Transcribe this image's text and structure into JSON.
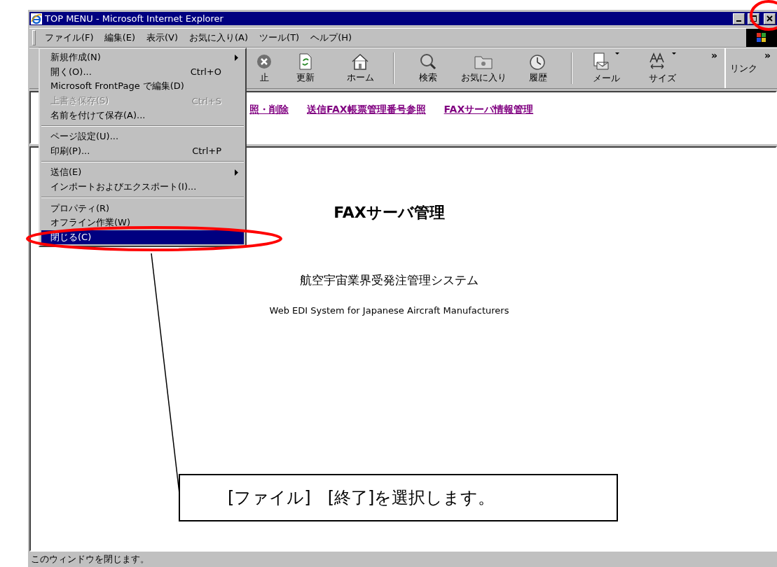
{
  "window": {
    "title": "TOP MENU - Microsoft Internet Explorer"
  },
  "menu_bar": [
    {
      "label": "ファイル(F)",
      "selected": true
    },
    {
      "label": "編集(E)",
      "selected": false
    },
    {
      "label": "表示(V)",
      "selected": false
    },
    {
      "label": "お気に入り(A)",
      "selected": false
    },
    {
      "label": "ツール(T)",
      "selected": false
    },
    {
      "label": "ヘルプ(H)",
      "selected": false
    }
  ],
  "toolbar": {
    "buttons": [
      {
        "label": "止",
        "dropdown": false
      },
      {
        "label": "更新",
        "dropdown": false
      },
      {
        "label": "ホーム",
        "dropdown": false
      },
      {
        "label": "検索",
        "dropdown": false
      },
      {
        "label": "お気に入り",
        "dropdown": false
      },
      {
        "label": "履歴",
        "dropdown": false
      },
      {
        "label": "メール",
        "dropdown": true
      },
      {
        "label": "サイズ",
        "dropdown": true
      }
    ],
    "more": "»",
    "links": "リンク",
    "links_more": "»"
  },
  "file_menu": [
    {
      "kind": "item",
      "label": "新規作成(N)",
      "submenu": true,
      "disabled": false,
      "selected": false
    },
    {
      "kind": "item",
      "label": "開く(O)...",
      "shortcut": "Ctrl+O",
      "submenu": false,
      "disabled": false,
      "selected": false
    },
    {
      "kind": "item",
      "label": "Microsoft FrontPage  で編集(D)",
      "submenu": false,
      "disabled": false,
      "selected": false
    },
    {
      "kind": "item",
      "label": "上書き保存(S)",
      "shortcut": "Ctrl+S",
      "submenu": false,
      "disabled": true,
      "selected": false
    },
    {
      "kind": "item",
      "label": "名前を付けて保存(A)...",
      "submenu": false,
      "disabled": false,
      "selected": false
    },
    {
      "kind": "separator"
    },
    {
      "kind": "item",
      "label": "ページ設定(U)...",
      "submenu": false,
      "disabled": false,
      "selected": false
    },
    {
      "kind": "item",
      "label": "印刷(P)...",
      "shortcut": "Ctrl+P",
      "submenu": false,
      "disabled": false,
      "selected": false
    },
    {
      "kind": "separator"
    },
    {
      "kind": "item",
      "label": "送信(E)",
      "submenu": true,
      "disabled": false,
      "selected": false
    },
    {
      "kind": "item",
      "label": "インポートおよびエクスポート(I)...",
      "submenu": false,
      "disabled": false,
      "selected": false
    },
    {
      "kind": "separator"
    },
    {
      "kind": "item",
      "label": "プロパティ(R)",
      "submenu": false,
      "disabled": false,
      "selected": false
    },
    {
      "kind": "item",
      "label": "オフライン作業(W)",
      "submenu": false,
      "disabled": false,
      "selected": false
    },
    {
      "kind": "item",
      "label": "閉じる(C)",
      "submenu": false,
      "disabled": false,
      "selected": true
    }
  ],
  "nav_links": [
    "照・削除",
    "送信FAX帳票管理番号参照",
    "FAXサーバ情報管理"
  ],
  "page": {
    "title": "FAXサーバ管理",
    "subtitle": "航空宇宙業界受発注管理システム",
    "subtitle_en": "Web EDI System for Japanese Aircraft Manufacturers"
  },
  "status_bar": "このウィンドウを閉じます。",
  "callout": {
    "text": "[ファイル]　[終了]を選択します。"
  }
}
